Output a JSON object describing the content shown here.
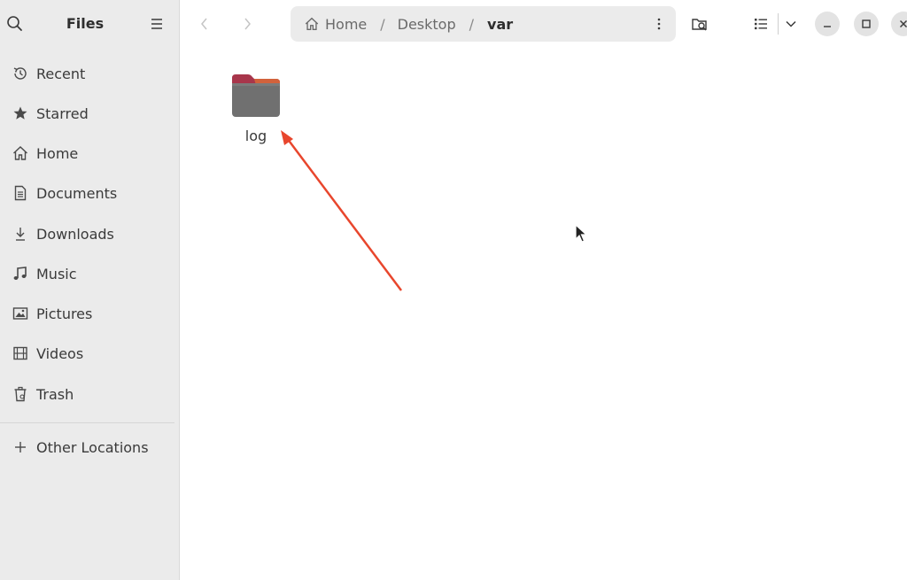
{
  "sidebar": {
    "title": "Files",
    "items": [
      {
        "label": "Recent",
        "icon": "clock-icon"
      },
      {
        "label": "Starred",
        "icon": "star-icon"
      },
      {
        "label": "Home",
        "icon": "home-icon"
      },
      {
        "label": "Documents",
        "icon": "document-icon"
      },
      {
        "label": "Downloads",
        "icon": "download-icon"
      },
      {
        "label": "Music",
        "icon": "music-icon"
      },
      {
        "label": "Pictures",
        "icon": "picture-icon"
      },
      {
        "label": "Videos",
        "icon": "video-icon"
      },
      {
        "label": "Trash",
        "icon": "trash-icon"
      },
      {
        "label": "Other Locations",
        "icon": "plus-icon"
      }
    ]
  },
  "pathbar": {
    "crumbs": [
      {
        "label": "Home"
      },
      {
        "label": "Desktop"
      },
      {
        "label": "var"
      }
    ]
  },
  "files": [
    {
      "name": "log",
      "type": "folder"
    }
  ],
  "colors": {
    "sidebar_bg": "#ebebeb",
    "folder_body": "#6e6e6e",
    "folder_tab": "#b0374a",
    "annotation_arrow": "#e8462d"
  }
}
